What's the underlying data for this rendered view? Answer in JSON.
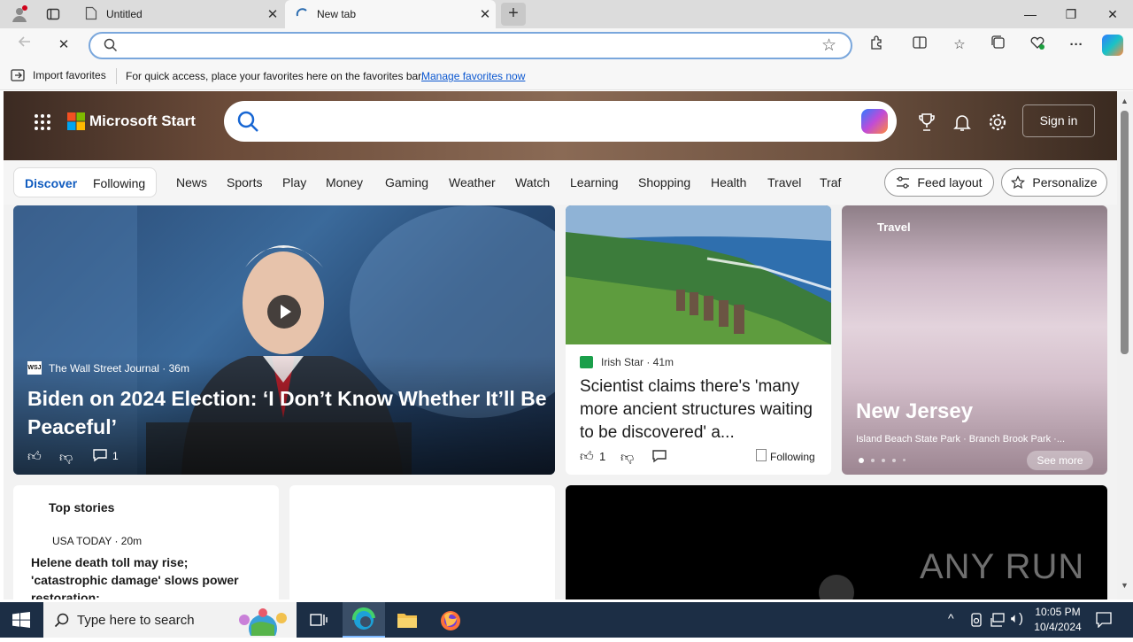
{
  "tabs": [
    {
      "title": "Untitled"
    },
    {
      "title": "New tab"
    }
  ],
  "window": {
    "minimize": "—",
    "restore": "❐",
    "close": "✕"
  },
  "favorites_bar": {
    "import_label": "Import favorites",
    "message": "For quick access, place your favorites here on the favorites bar.",
    "manage_link": "Manage favorites now"
  },
  "msstart": {
    "brand": "Microsoft Start",
    "signin": "Sign in",
    "nav_primary": [
      "Discover",
      "Following"
    ],
    "nav_items": [
      "News",
      "Sports",
      "Play",
      "Money",
      "Gaming",
      "Weather",
      "Watch",
      "Learning",
      "Shopping",
      "Health",
      "Travel",
      "Traf"
    ],
    "feed_layout": "Feed layout",
    "personalize": "Personalize"
  },
  "hero_card": {
    "source": "The Wall Street Journal · 36m",
    "source_logo": "WSJ",
    "headline": "Biden on 2024 Election: ‘I Don’t Know Whether It’ll Be Peaceful’",
    "comments": "1"
  },
  "irish_card": {
    "source": "Irish Star · 41m",
    "headline": "Scientist claims there's 'many more ancient structures waiting to be discovered' a...",
    "likes": "1",
    "following": "Following"
  },
  "travel_card": {
    "tag": "Travel",
    "title": "New Jersey",
    "subtitle": "Island Beach State Park · Branch Brook Park ·...",
    "see_more": "See more"
  },
  "top_stories": {
    "heading": "Top stories",
    "source": "USA TODAY · 20m",
    "headline": "Helene death toll may rise; 'catastrophic damage' slows power restoration:..."
  },
  "watermark": "ANY RUN",
  "taskbar": {
    "search_placeholder": "Type here to search",
    "time": "10:05 PM",
    "date": "10/4/2024"
  }
}
